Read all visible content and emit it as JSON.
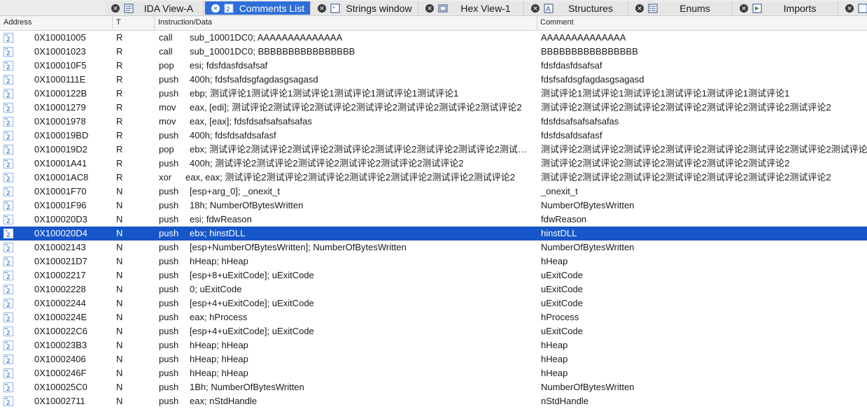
{
  "tabs": [
    {
      "label": "IDA View-A",
      "icon": "ida-view-icon",
      "active": false
    },
    {
      "label": "Comments List",
      "icon": "comments-list-icon",
      "active": true
    },
    {
      "label": "Strings window",
      "icon": "strings-icon",
      "active": false
    },
    {
      "label": "Hex View-1",
      "icon": "hex-view-icon",
      "active": false
    },
    {
      "label": "Structures",
      "icon": "structures-icon",
      "active": false
    },
    {
      "label": "Enums",
      "icon": "enums-icon",
      "active": false
    },
    {
      "label": "Imports",
      "icon": "imports-icon",
      "active": false
    }
  ],
  "columns": {
    "address": "Address",
    "type": "T",
    "instruction": "Instruction/Data",
    "comment": "Comment"
  },
  "rows": [
    {
      "address": "0X10001005",
      "type": "R",
      "mnemonic": "call",
      "operand": "sub_10001DC0; AAAAAAAAAAAAAA",
      "comment": "AAAAAAAAAAAAAA"
    },
    {
      "address": "0X10001023",
      "type": "R",
      "mnemonic": "call",
      "operand": "sub_10001DC0; BBBBBBBBBBBBBBBB",
      "comment": "BBBBBBBBBBBBBBBB"
    },
    {
      "address": "0X100010F5",
      "type": "R",
      "mnemonic": "pop",
      "operand": "esi; fdsfdasfdsafsaf",
      "comment": "fdsfdasfdsafsaf"
    },
    {
      "address": "0X1000111E",
      "type": "R",
      "mnemonic": "push",
      "operand": "400h; fdsfsafdsgfagdasgsagasd",
      "comment": "fdsfsafdsgfagdasgsagasd"
    },
    {
      "address": "0X1000122B",
      "type": "R",
      "mnemonic": "push",
      "operand": "ebp; 测试评论1测试评论1测试评论1测试评论1测试评论1测试评论1",
      "comment": "测试评论1测试评论1测试评论1测试评论1测试评论1测试评论1"
    },
    {
      "address": "0X10001279",
      "type": "R",
      "mnemonic": "mov",
      "operand": "eax, [edi]; 测试评论2测试评论2测试评论2测试评论2测试评论2测试评论2测试评论2",
      "comment": "测试评论2测试评论2测试评论2测试评论2测试评论2测试评论2测试评论2"
    },
    {
      "address": "0X10001978",
      "type": "R",
      "mnemonic": "mov",
      "operand": "eax, [eax]; fdsfdsafsafsafsafas",
      "comment": "fdsfdsafsafsafsafas"
    },
    {
      "address": "0X100019BD",
      "type": "R",
      "mnemonic": "push",
      "operand": "400h; fdsfdsafdsafasf",
      "comment": "fdsfdsafdsafasf"
    },
    {
      "address": "0X100019D2",
      "type": "R",
      "mnemonic": "pop",
      "operand": "ebx; 测试评论2测试评论2测试评论2测试评论2测试评论2测试评论2测试评论2测试评论2测试...",
      "comment": "测试评论2测试评论2测试评论2测试评论2测试评论2测试评论2测试评论2测试评论2测试评论"
    },
    {
      "address": "0X10001A41",
      "type": "R",
      "mnemonic": "push",
      "operand": "400h; 测试评论2测试评论2测试评论2测试评论2测试评论2测试评论2",
      "comment": "测试评论2测试评论2测试评论2测试评论2测试评论2测试评论2"
    },
    {
      "address": "0X10001AC8",
      "type": "R",
      "mnemonic": "xor",
      "operand": "eax, eax; 测试评论2测试评论2测试评论2测试评论2测试评论2测试评论2测试评论2",
      "comment": "测试评论2测试评论2测试评论2测试评论2测试评论2测试评论2测试评论2",
      "wide": true
    },
    {
      "address": "0X10001F70",
      "type": "N",
      "mnemonic": "push",
      "operand": "[esp+arg_0]; _onexit_t",
      "comment": "_onexit_t"
    },
    {
      "address": "0X10001F96",
      "type": "N",
      "mnemonic": "push",
      "operand": "18h; NumberOfBytesWritten",
      "comment": "NumberOfBytesWritten"
    },
    {
      "address": "0X100020D3",
      "type": "N",
      "mnemonic": "push",
      "operand": "esi; fdwReason",
      "comment": "fdwReason"
    },
    {
      "address": "0X100020D4",
      "type": "N",
      "mnemonic": "push",
      "operand": "ebx; hinstDLL",
      "comment": "hinstDLL",
      "selected": true
    },
    {
      "address": "0X10002143",
      "type": "N",
      "mnemonic": "push",
      "operand": "[esp+NumberOfBytesWritten]; NumberOfBytesWritten",
      "comment": "NumberOfBytesWritten"
    },
    {
      "address": "0X100021D7",
      "type": "N",
      "mnemonic": "push",
      "operand": "hHeap; hHeap",
      "comment": "hHeap"
    },
    {
      "address": "0X10002217",
      "type": "N",
      "mnemonic": "push",
      "operand": "[esp+8+uExitCode]; uExitCode",
      "comment": "uExitCode"
    },
    {
      "address": "0X10002228",
      "type": "N",
      "mnemonic": "push",
      "operand": "0; uExitCode",
      "comment": "uExitCode"
    },
    {
      "address": "0X10002244",
      "type": "N",
      "mnemonic": "push",
      "operand": "[esp+4+uExitCode]; uExitCode",
      "comment": "uExitCode"
    },
    {
      "address": "0X1000224E",
      "type": "N",
      "mnemonic": "push",
      "operand": "eax; hProcess",
      "comment": "hProcess"
    },
    {
      "address": "0X100022C6",
      "type": "N",
      "mnemonic": "push",
      "operand": "[esp+4+uExitCode]; uExitCode",
      "comment": "uExitCode"
    },
    {
      "address": "0X100023B3",
      "type": "N",
      "mnemonic": "push",
      "operand": "hHeap; hHeap",
      "comment": "hHeap"
    },
    {
      "address": "0X10002406",
      "type": "N",
      "mnemonic": "push",
      "operand": "hHeap; hHeap",
      "comment": "hHeap"
    },
    {
      "address": "0X1000246F",
      "type": "N",
      "mnemonic": "push",
      "operand": "hHeap; hHeap",
      "comment": "hHeap"
    },
    {
      "address": "0X100025C0",
      "type": "N",
      "mnemonic": "push",
      "operand": "1Bh; NumberOfBytesWritten",
      "comment": "NumberOfBytesWritten"
    },
    {
      "address": "0X10002711",
      "type": "N",
      "mnemonic": "push",
      "operand": "eax; nStdHandle",
      "comment": "nStdHandle"
    }
  ],
  "colors": {
    "accent": "#2d6fd7",
    "selected_row": "#1656c9"
  }
}
